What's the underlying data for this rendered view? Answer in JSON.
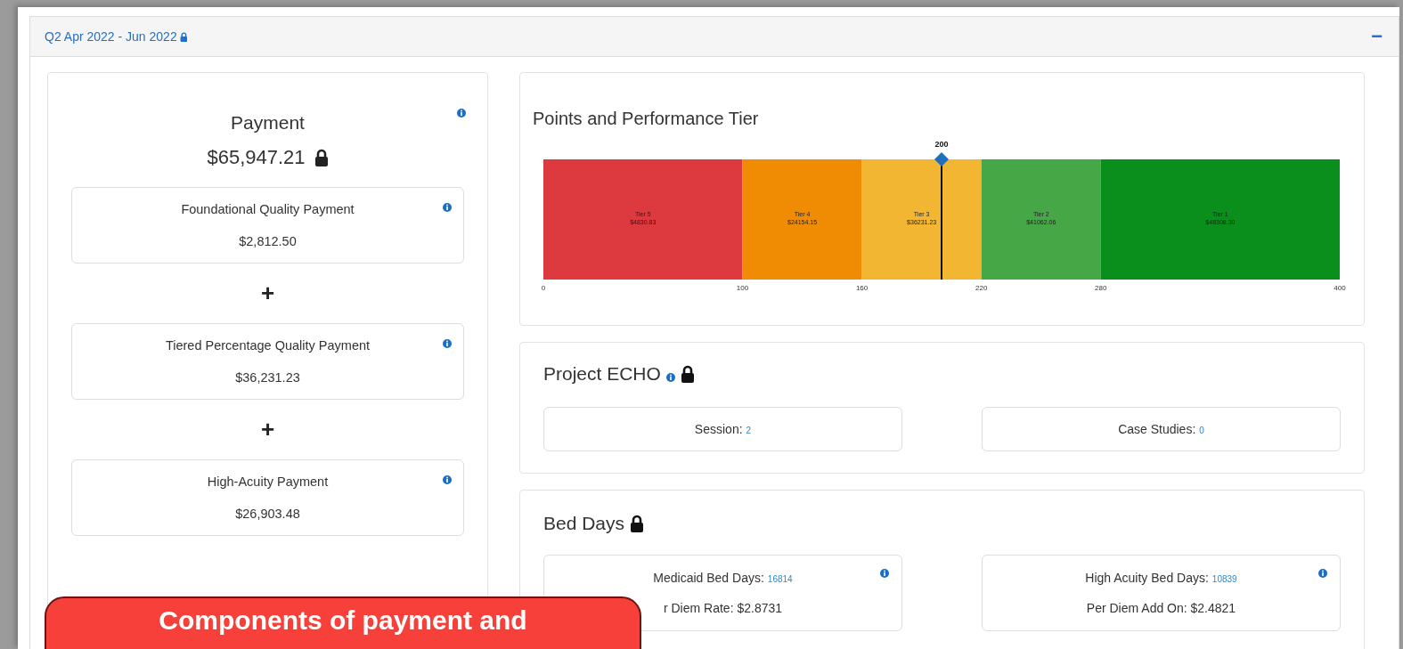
{
  "panel": {
    "title": "Q2 Apr 2022 - Jun 2022",
    "locked": true,
    "collapse_label": "−"
  },
  "payment": {
    "title": "Payment",
    "total": "$65,947.21",
    "locked": true,
    "components": [
      {
        "title": "Foundational Quality Payment",
        "amount": "$2,812.50"
      },
      {
        "operator": "+",
        "title": "Tiered Percentage Quality Payment",
        "amount": "$36,231.23"
      },
      {
        "operator": "+",
        "title": "High-Acuity Payment",
        "amount": "$26,903.48"
      }
    ]
  },
  "performance": {
    "title": "Points and Performance Tier",
    "chart_data": {
      "type": "bar",
      "orientation": "horizontal",
      "stacked": true,
      "series": [
        {
          "name": "Tier 5",
          "color": "#dc3a3f",
          "values": [
            100
          ]
        },
        {
          "name": "Tier 4",
          "color": "#f08c04",
          "values": [
            60
          ]
        },
        {
          "name": "Tier 3",
          "color": "#f2b632",
          "values": [
            60
          ]
        },
        {
          "name": "Tier 2",
          "color": "#45a745",
          "values": [
            60
          ]
        },
        {
          "name": "Tier 1",
          "color": "#0a8f1c",
          "values": [
            120
          ]
        }
      ],
      "value_labels": [
        "$4830.83",
        "$24154.15",
        "$36231.23",
        "$41062.06",
        "$48308.30"
      ],
      "xlim": [
        0,
        400
      ],
      "xticks": [
        0,
        100,
        160,
        220,
        280,
        400
      ],
      "ref_lines": [
        {
          "axis": "x",
          "value": 200,
          "label": "200"
        }
      ]
    }
  },
  "echo": {
    "title": "Project ECHO",
    "locked": true,
    "stats": [
      {
        "label": "Session:",
        "value": "2"
      },
      {
        "label": "Case Studies:",
        "value": "0"
      }
    ]
  },
  "bed_days": {
    "title": "Bed Days",
    "locked": true,
    "cards": [
      {
        "label": "Medicaid Bed Days:",
        "value": "16814",
        "detail": "r Diem Rate: $2.8731"
      },
      {
        "label": "High Acuity Bed Days:",
        "value": "10839",
        "detail": "Per Diem Add On: $2.4821"
      }
    ]
  },
  "callout": {
    "text": "Components of payment and"
  }
}
